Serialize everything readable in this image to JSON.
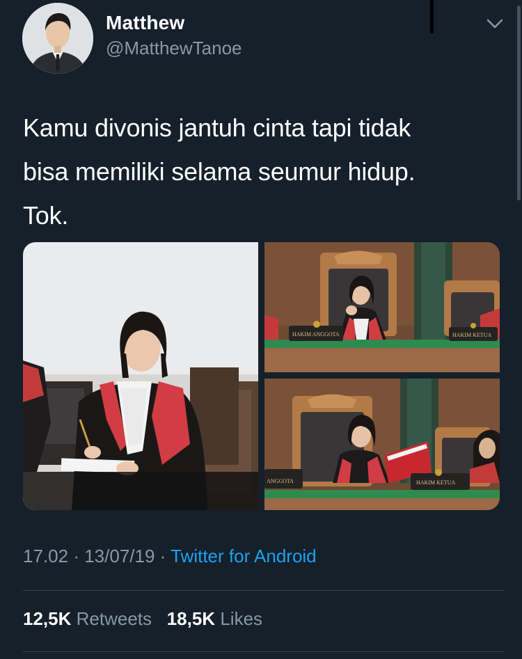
{
  "tweet": {
    "display_name": "Matthew",
    "handle": "@MatthewTanoe",
    "text_lines": [
      "Kamu divonis jantuh cinta tapi tidak",
      "bisa memiliki selama seumur hidup.",
      "Tok."
    ],
    "time": "17.02",
    "date": "13/07/19",
    "separator": "·",
    "source": "Twitter for Android",
    "retweets_count": "12,5K",
    "retweets_label": "Retweets",
    "likes_count": "18,5K",
    "likes_label": "Likes"
  },
  "media": {
    "plaque_hakim_anggota": "HAKIM ANGGOTA",
    "plaque_hakim_ketua": "HAKIM KETUA",
    "plaque_anggota": "ANGGOTA"
  },
  "colors": {
    "background": "#15202b",
    "secondary_text": "#8899a6",
    "link": "#1da1f2",
    "divider": "#38444d"
  },
  "icons": {
    "menu": "chevron-down-icon",
    "avatar": "avatar"
  }
}
